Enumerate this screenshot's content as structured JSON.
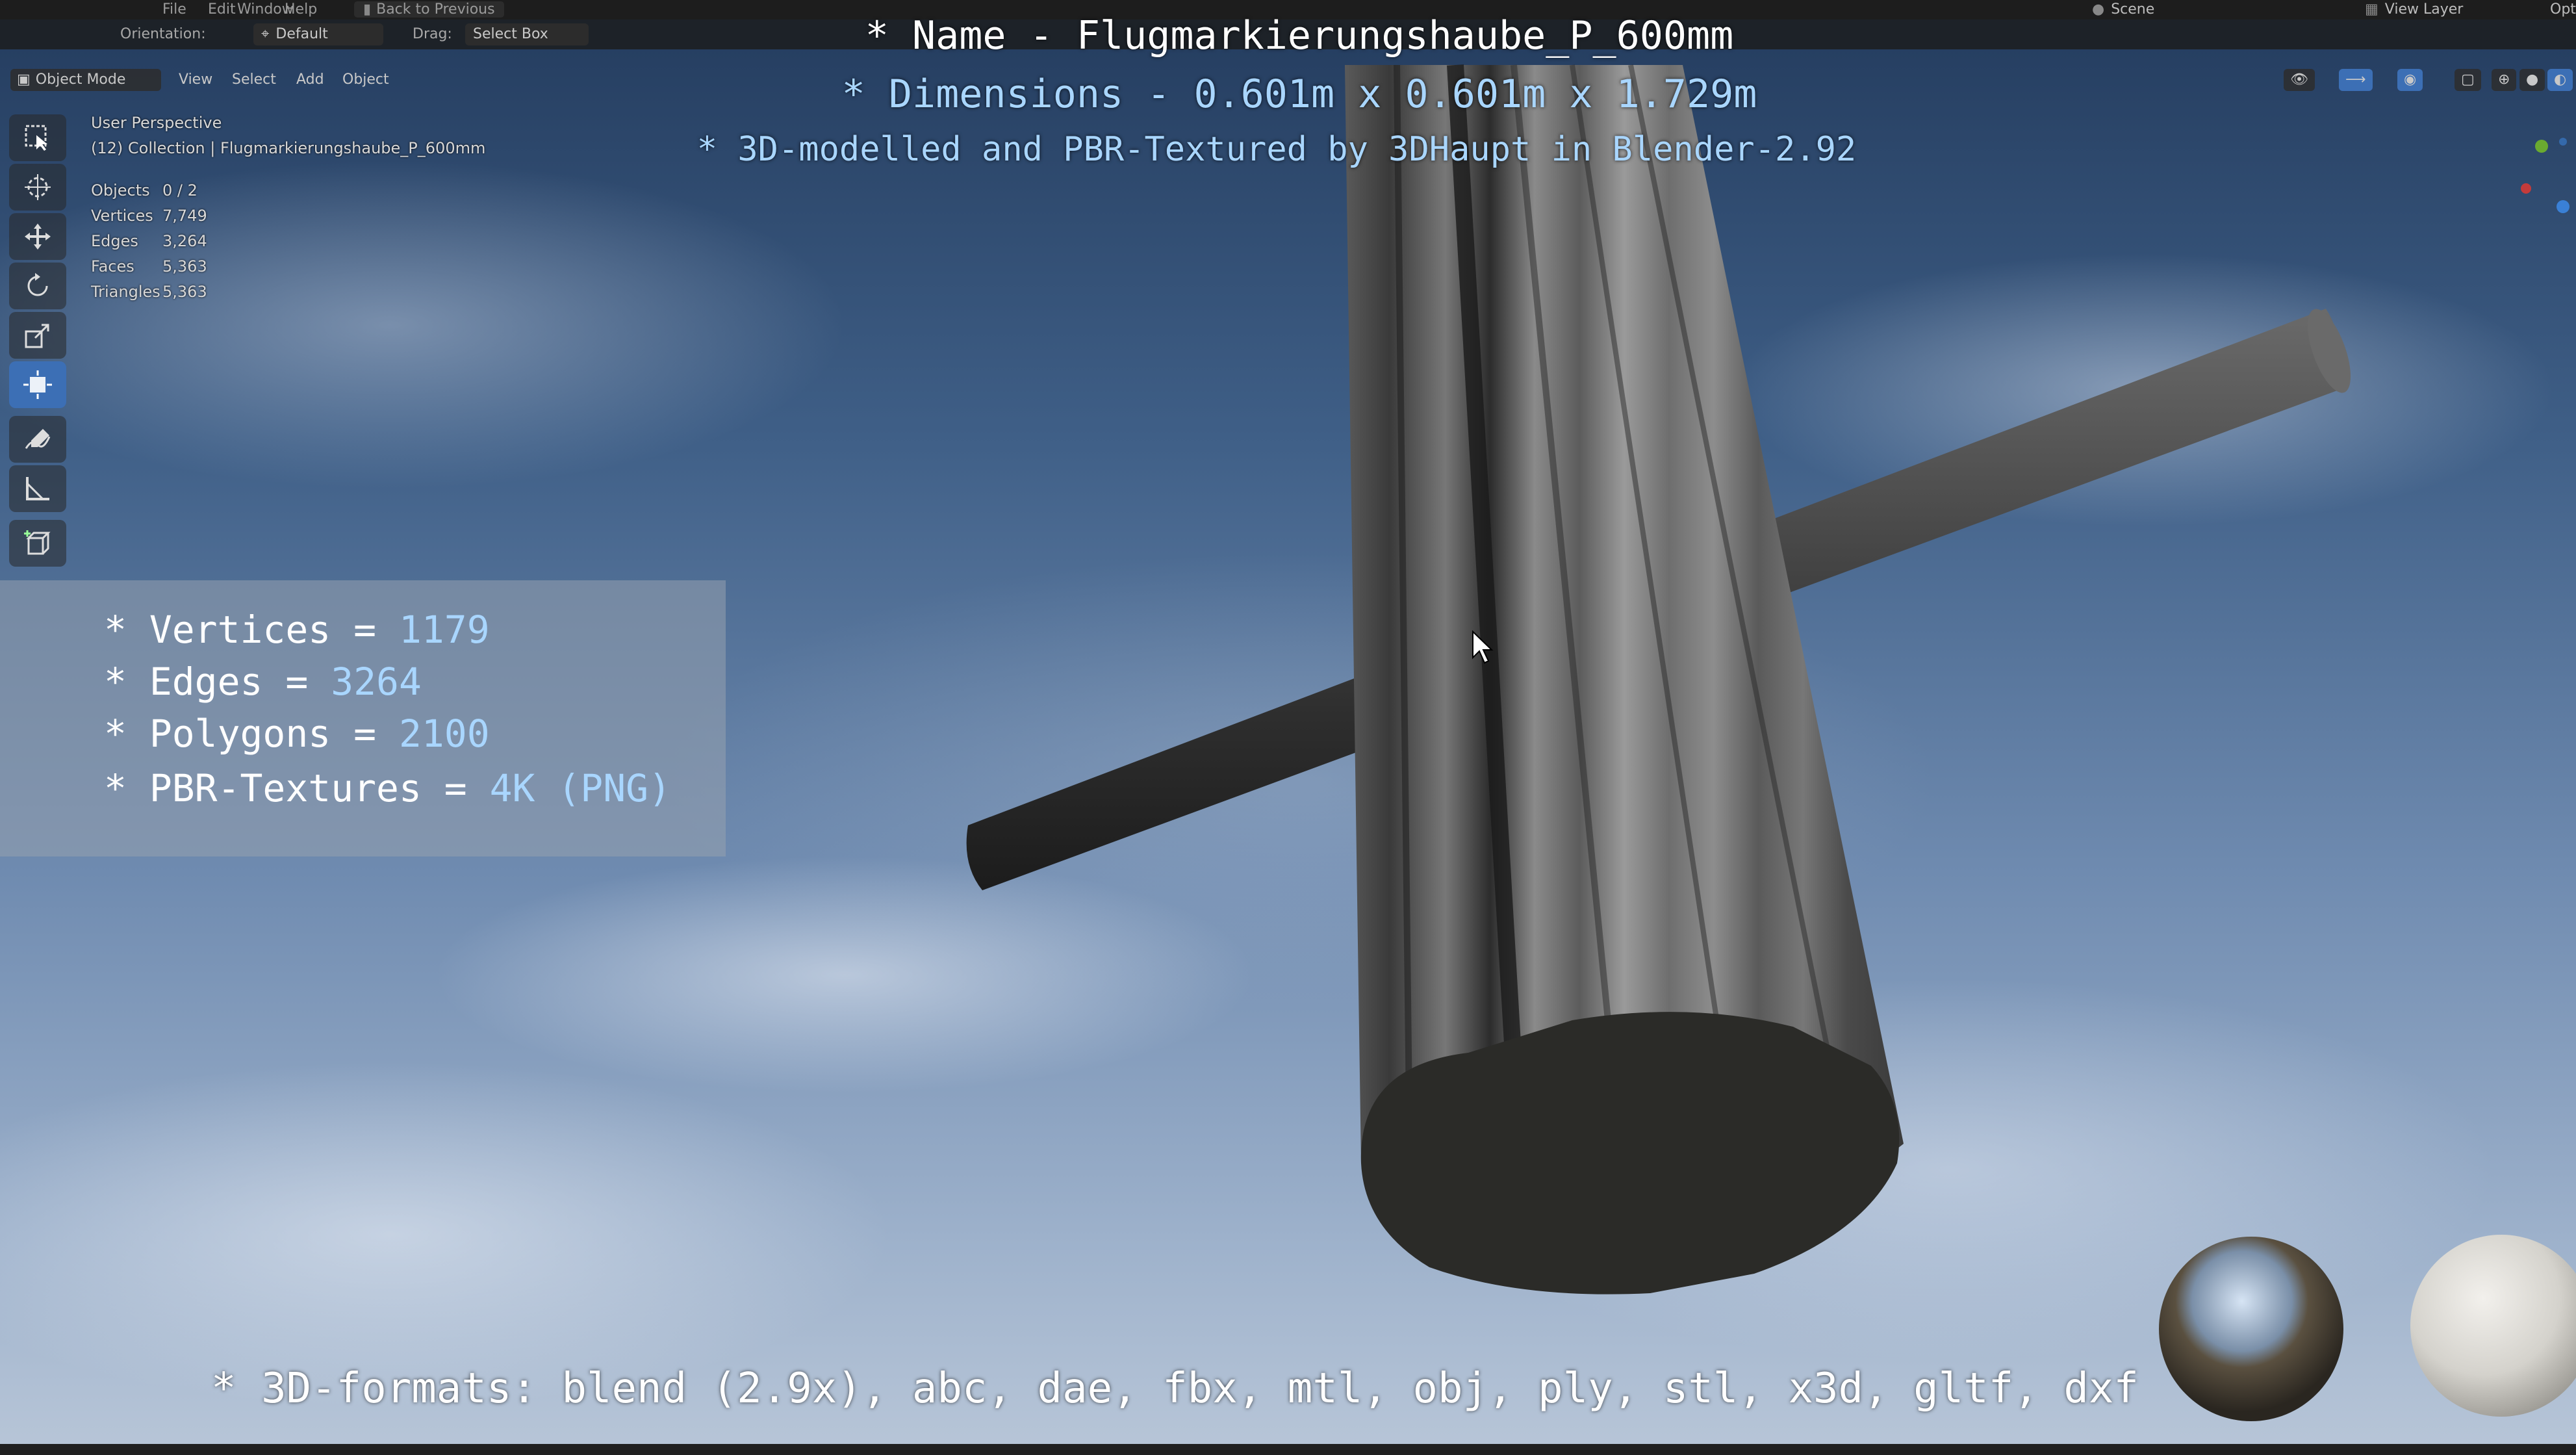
{
  "app": {
    "menu": [
      "File",
      "Edit",
      "Window",
      "Help"
    ],
    "back_to_previous": "Back to Previous",
    "scene": "Scene",
    "view_layer": "View Layer",
    "options_label": "Opti"
  },
  "tool_header": {
    "orientation_label": "Orientation:",
    "orientation_value": "Default",
    "drag_label": "Drag:",
    "drag_value": "Select Box"
  },
  "viewport_header": {
    "mode": "Object Mode",
    "menus": [
      "View",
      "Select",
      "Add",
      "Object"
    ]
  },
  "overlay": {
    "perspective": "User Perspective",
    "collection": "(12) Collection | Flugmarkierungshaube_P_600mm",
    "stats": [
      {
        "label": "Objects",
        "value": "0 / 2"
      },
      {
        "label": "Vertices",
        "value": "7,749"
      },
      {
        "label": "Edges",
        "value": "3,264"
      },
      {
        "label": "Faces",
        "value": "5,363"
      },
      {
        "label": "Triangles",
        "value": "5,363"
      }
    ]
  },
  "titles": {
    "name": "* Name - Flugmarkierungshaube_P_600mm",
    "dimensions": "* Dimensions -  0.601m x 0.601m x 1.729m",
    "model": "* 3D-modelled and PBR-Textured by 3DHaupt in Blender-2.92"
  },
  "info": [
    {
      "label": "* Vertices = ",
      "value": "1179"
    },
    {
      "label": "* Edges = ",
      "value": "3264"
    },
    {
      "label": "* Polygons = ",
      "value": "2100"
    },
    {
      "label": "* PBR-Textures = ",
      "value": "4K (PNG)"
    }
  ],
  "formats": "* 3D-formats: blend (2.9x), abc, dae, fbx, mtl, obj, ply, stl, x3d, gltf, dxf",
  "tools": [
    {
      "name": "select-box-tool-icon",
      "active": false
    },
    {
      "name": "cursor-tool-icon",
      "active": false
    },
    {
      "name": "move-tool-icon",
      "active": false
    },
    {
      "name": "rotate-tool-icon",
      "active": false
    },
    {
      "name": "scale-tool-icon",
      "active": false
    },
    {
      "name": "transform-tool-icon",
      "active": true
    },
    {
      "name": "annotate-tool-icon",
      "active": false
    },
    {
      "name": "measure-tool-icon",
      "active": false
    },
    {
      "name": "add-cube-tool-icon",
      "active": false
    }
  ],
  "colors": {
    "accent": "#3c6fb5",
    "title_blue": "#a9d6ff",
    "object_dark": "#2d2d2d"
  }
}
